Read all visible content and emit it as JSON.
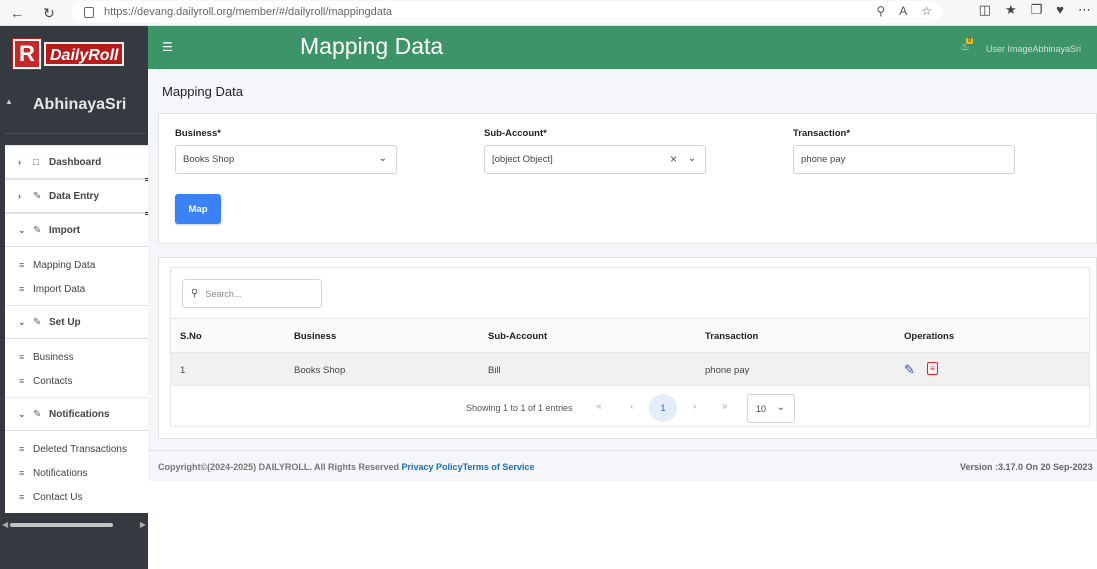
{
  "browser": {
    "url": "https://devang.dailyroll.org/member/#/dailyroll/mappingdata"
  },
  "sidebar": {
    "logo_text": "DailyRoll",
    "logo_mark": "R",
    "user_name": "AbhinayaSri",
    "menu": [
      {
        "label": "Dashboard",
        "icon": "document-icon",
        "expanded": false
      },
      {
        "label": "Data Entry",
        "icon": "pencil-icon",
        "expanded": false
      },
      {
        "label": "Import",
        "icon": "pencil-icon",
        "expanded": true,
        "items": [
          "Mapping Data",
          "Import Data"
        ]
      },
      {
        "label": "Set Up",
        "icon": "pencil-icon",
        "expanded": true,
        "items": [
          "Business",
          "Contacts"
        ]
      },
      {
        "label": "Notifications",
        "icon": "pencil-icon",
        "expanded": true,
        "items": [
          "Deleted Transactions",
          "Notifications",
          "Contact Us"
        ]
      }
    ]
  },
  "header": {
    "title": "Mapping Data",
    "notification_count": "0",
    "user_label": "User ImageAbhinayaSri"
  },
  "main": {
    "title": "Mapping Data",
    "form": {
      "business_label": "Business*",
      "business_value": "Books Shop",
      "subaccount_label": "Sub-Account*",
      "subaccount_value": "[object Object]",
      "transaction_label": "Transaction*",
      "transaction_value": "phone pay",
      "map_label": "Map"
    },
    "table": {
      "search_placeholder": "Search...",
      "columns": [
        "S.No",
        "Business",
        "Sub-Account",
        "Transaction",
        "Operations"
      ],
      "rows": [
        {
          "sno": "1",
          "business": "Books Shop",
          "subaccount": "Bill",
          "transaction": "phone pay"
        }
      ],
      "pagination": {
        "info": "Showing 1 to 1 of 1 entries",
        "current_page": "1",
        "page_size": "10"
      }
    }
  },
  "footer": {
    "copyright": "Copyright©(2024-2025) DAILYROLL. All Rights Reserved ",
    "privacy": "Privacy Policy",
    "terms": "Terms of Service",
    "version": "Version :3.17.0 On 20 Sep-2023"
  },
  "colors": {
    "header_green": "#3d9469",
    "sidebar_dark": "#343a40",
    "primary_blue": "#3b82f6",
    "danger_red": "#d9262f",
    "link_blue": "#1d6fb8"
  }
}
